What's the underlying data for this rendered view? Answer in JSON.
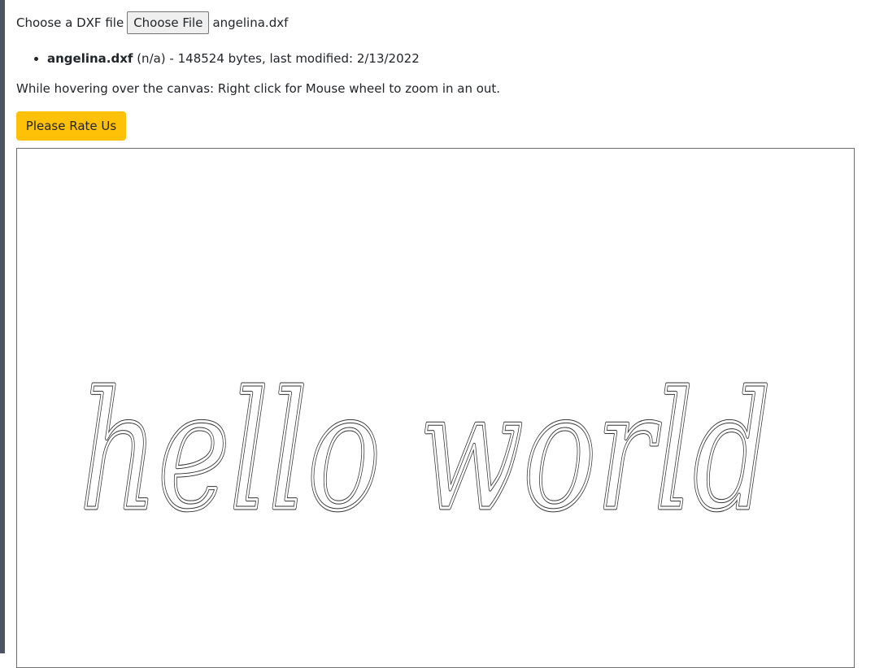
{
  "file_input": {
    "label": "Choose a DXF file",
    "button_label": "Choose File",
    "chosen_file": "angelina.dxf"
  },
  "file_info": {
    "name": "angelina.dxf",
    "details": " (n/a) - 148524 bytes, last modified: 2/13/2022"
  },
  "hint": "While hovering over the canvas: Right click for Mouse wheel to zoom in an out.",
  "rate_button": "Please Rate Us",
  "canvas": {
    "drawing_text": "hello world",
    "stroke_color": "#333333"
  },
  "colors": {
    "accent": "#ffc107",
    "left_rail": "#4b5563"
  }
}
